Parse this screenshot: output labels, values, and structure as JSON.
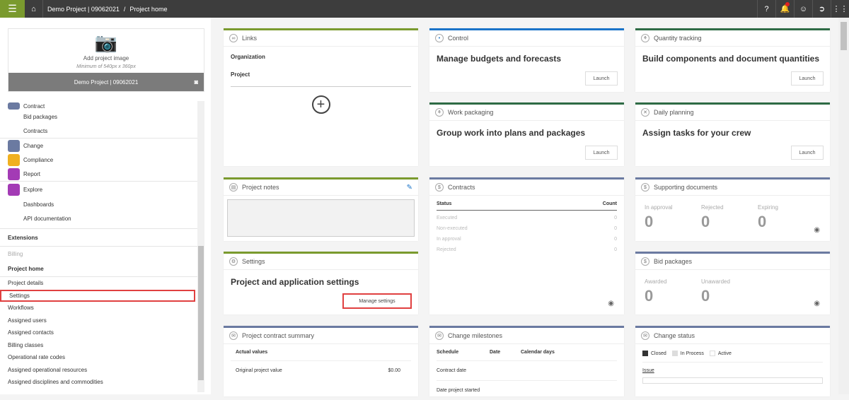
{
  "topbar": {
    "project": "Demo Project | 09062021",
    "separator": "/",
    "page": "Project home"
  },
  "image_card": {
    "add_label": "Add project image",
    "min_label": "Minimum of 540px x 360px",
    "project_name": "Demo Project | 09062021"
  },
  "nav": {
    "contract": "Contract",
    "bid_packages": "Bid packages",
    "contracts": "Contracts",
    "change": "Change",
    "compliance": "Compliance",
    "report": "Report",
    "explore": "Explore",
    "dashboards": "Dashboards",
    "api_docs": "API documentation",
    "extensions": "Extensions",
    "billing": "Billing",
    "project_home": "Project home",
    "items": [
      "Project details",
      "Settings",
      "Workflows",
      "Assigned users",
      "Assigned contacts",
      "Billing classes",
      "Operational rate codes",
      "Assigned operational resources",
      "Assigned disciplines and commodities"
    ]
  },
  "colors": {
    "olive": "#7a9a2e",
    "blue": "#1a73c8",
    "green": "#2e6b45",
    "slate": "#6b7aa1",
    "compliance": "#f0b020",
    "report": "#a33bb5"
  },
  "links": {
    "title": "Links",
    "org": "Organization",
    "project": "Project"
  },
  "notes": {
    "title": "Project notes"
  },
  "settings": {
    "title": "Settings",
    "heading": "Project and application settings",
    "button": "Manage settings"
  },
  "pcs": {
    "title": "Project contract summary",
    "subheading": "Actual values",
    "row1_label": "Original project value",
    "row1_value": "$0.00"
  },
  "control": {
    "title": "Control",
    "heading": "Manage budgets and forecasts",
    "button": "Launch"
  },
  "quantity": {
    "title": "Quantity tracking",
    "heading": "Build components and document quantities",
    "button": "Launch"
  },
  "work": {
    "title": "Work packaging",
    "heading": "Group work into plans and packages",
    "button": "Launch"
  },
  "daily": {
    "title": "Daily planning",
    "heading": "Assign tasks for your crew",
    "button": "Launch"
  },
  "contracts_card": {
    "title": "Contracts",
    "col1": "Status",
    "col2": "Count",
    "rows": [
      {
        "s": "Executed",
        "c": "0"
      },
      {
        "s": "Non-executed",
        "c": "0"
      },
      {
        "s": "In approval",
        "c": "0"
      },
      {
        "s": "Rejected",
        "c": "0"
      }
    ]
  },
  "supporting": {
    "title": "Supporting documents",
    "stats": [
      {
        "l": "In approval",
        "v": "0"
      },
      {
        "l": "Rejected",
        "v": "0"
      },
      {
        "l": "Expiring",
        "v": "0"
      }
    ]
  },
  "bid": {
    "title": "Bid packages",
    "stats": [
      {
        "l": "Awarded",
        "v": "0"
      },
      {
        "l": "Unawarded",
        "v": "0"
      }
    ]
  },
  "milestones": {
    "title": "Change milestones",
    "cols": [
      "Schedule",
      "Date",
      "Calendar days"
    ],
    "rows": [
      "Contract date",
      "Date project started"
    ]
  },
  "change_status": {
    "title": "Change status",
    "legend": [
      "Closed",
      "In Process",
      "Active"
    ],
    "issue": "Issue"
  }
}
